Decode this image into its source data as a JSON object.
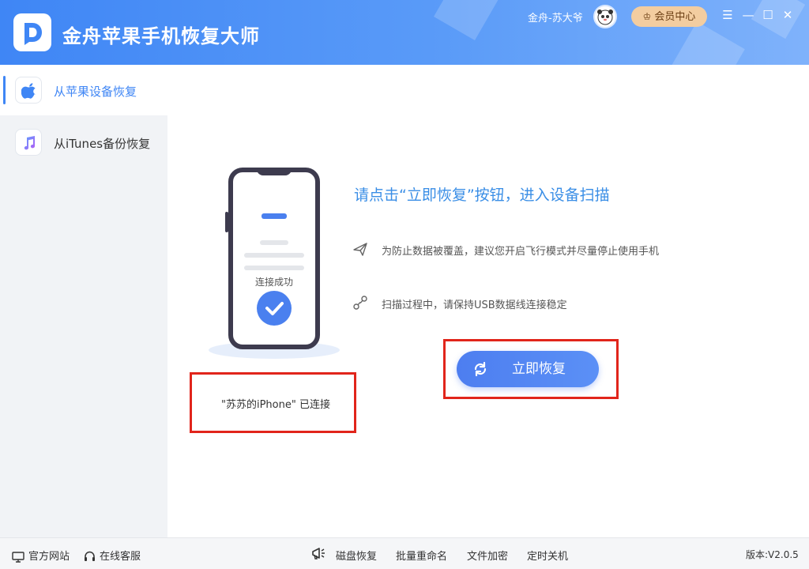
{
  "app": {
    "title": "金舟苹果手机恢复大师"
  },
  "header": {
    "user_name": "金舟-苏大爷",
    "vip_label": "会员中心",
    "window_controls": [
      "menu-icon",
      "minimize-icon",
      "maximize-icon",
      "close-icon"
    ]
  },
  "sidebar": {
    "items": [
      {
        "label": "从苹果设备恢复",
        "icon": "apple-icon",
        "active": true
      },
      {
        "label": "从iTunes备份恢复",
        "icon": "music-note-icon",
        "active": false
      }
    ]
  },
  "main": {
    "phone_status": "连接成功",
    "connected_text": "\"苏苏的iPhone\" 已连接",
    "hint_title": "请点击“立即恢复”按钮，进入设备扫描",
    "tips": [
      {
        "icon": "airplane-icon",
        "text": "为防止数据被覆盖，建议您开启飞行模式并尽量停止使用手机"
      },
      {
        "icon": "usb-cable-icon",
        "text": "扫描过程中，请保持USB数据线连接稳定"
      }
    ],
    "restore_button": "立即恢复"
  },
  "footer": {
    "links": [
      {
        "label": "官方网站",
        "icon": "monitor-icon"
      },
      {
        "label": "在线客服",
        "icon": "headset-icon"
      }
    ],
    "tools_icon": "megaphone-icon",
    "tools": [
      "磁盘恢复",
      "批量重命名",
      "文件加密",
      "定时关机"
    ],
    "version": "版本:V2.0.5"
  },
  "colors": {
    "accent": "#3f86f5",
    "highlight_box": "#e1251b",
    "vip": "#f3cda0"
  }
}
